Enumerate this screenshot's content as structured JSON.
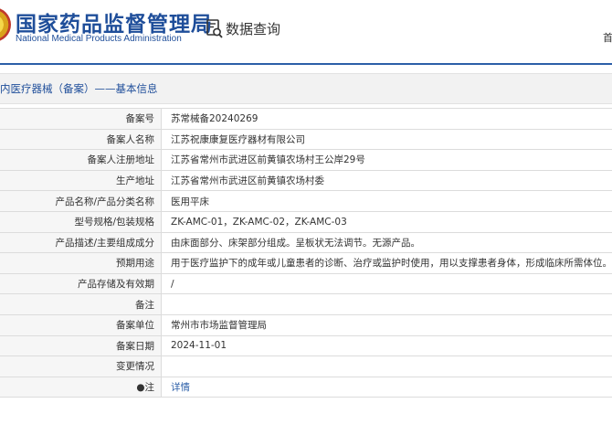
{
  "header": {
    "site_title_cn": "国家药品监督管理局",
    "site_title_en": "National Medical Products Administration",
    "search_label": "数据查询",
    "right_stub": "首"
  },
  "section": {
    "title": "内医疗器械（备案）——基本信息"
  },
  "rows": [
    {
      "key": "备案号",
      "value": "苏常械备20240269"
    },
    {
      "key": "备案人名称",
      "value": "江苏祝康康复医疗器材有限公司"
    },
    {
      "key": "备案人注册地址",
      "value": "江苏省常州市武进区前黄镇农场村王公岸29号"
    },
    {
      "key": "生产地址",
      "value": "江苏省常州市武进区前黄镇农场村委"
    },
    {
      "key": "产品名称/产品分类名称",
      "value": "医用平床"
    },
    {
      "key": "型号规格/包装规格",
      "value": "ZK-AMC-01，ZK-AMC-02，ZK-AMC-03"
    },
    {
      "key": "产品描述/主要组成成分",
      "value": "由床面部分、床架部分组成。呈板状无法调节。无源产品。"
    },
    {
      "key": "预期用途",
      "value": "用于医疗监护下的成年或儿童患者的诊断、治疗或监护时使用，用以支撑患者身体，形成临床所需体位。"
    },
    {
      "key": "产品存储及有效期",
      "value": "/"
    },
    {
      "key": "备注",
      "value": ""
    },
    {
      "key": "备案单位",
      "value": "常州市市场监督管理局"
    },
    {
      "key": "备案日期",
      "value": "2024-11-01"
    },
    {
      "key": "变更情况",
      "value": ""
    },
    {
      "key": "●注",
      "value": "详情"
    }
  ],
  "colors": {
    "brand_blue": "#1f4e9a",
    "header_line": "#2c5fa8",
    "link_blue": "#2c5fa8",
    "label_bg": "#f6f6f6"
  },
  "icons": {
    "logo": "nmpa-emblem",
    "search": "document-search-icon"
  }
}
